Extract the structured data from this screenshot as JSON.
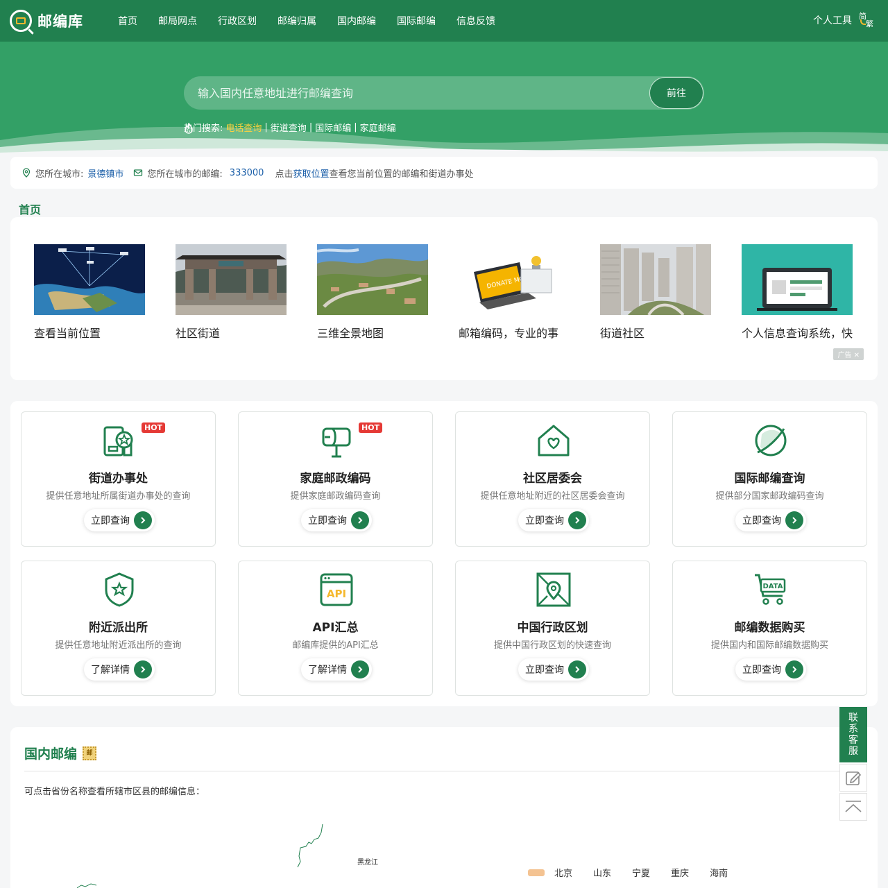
{
  "header": {
    "logo_text": "邮编库",
    "nav": [
      "首页",
      "邮局网点",
      "行政区划",
      "邮编归属",
      "国内邮编",
      "国际邮编",
      "信息反馈"
    ],
    "tools_label": "个人工具",
    "lang_a": "简",
    "lang_b": "繁"
  },
  "search": {
    "placeholder": "输入国内任意地址进行邮编查询",
    "button": "前往",
    "hot_label": "热门搜索:",
    "hot_highlight": "电话查询",
    "hot_links": [
      "街道查询",
      "国际邮编",
      "家庭邮编"
    ],
    "separator": "|"
  },
  "location": {
    "city_label": "您所在城市:",
    "city": "景德镇市",
    "postcode_label": "您所在城市的邮编:",
    "postcode": "333000",
    "prompt_prefix": "点击",
    "prompt_link": "获取位置",
    "prompt_suffix": "查看您当前位置的邮编和街道办事处"
  },
  "breadcrumb": "首页",
  "gallery": {
    "items": [
      {
        "caption": "查看当前位置"
      },
      {
        "caption": "社区街道"
      },
      {
        "caption": "三维全景地图"
      },
      {
        "caption": "邮箱编码，专业的事"
      },
      {
        "caption": "街道社区"
      },
      {
        "caption": "个人信息查询系统，快"
      }
    ],
    "ad_label": "广告",
    "donate_text": "DONATE MONEY"
  },
  "services": [
    {
      "title": "街道办事处",
      "desc": "提供任意地址所属街道办事处的查询",
      "button": "立即查询",
      "badge": "HOT",
      "icon": "id-badge-icon"
    },
    {
      "title": "家庭邮政编码",
      "desc": "提供家庭邮政编码查询",
      "button": "立即查询",
      "badge": "HOT",
      "icon": "mailbox-icon"
    },
    {
      "title": "社区居委会",
      "desc": "提供任意地址附近的社区居委会查询",
      "button": "立即查询",
      "badge": "",
      "icon": "house-heart-icon"
    },
    {
      "title": "国际邮编查询",
      "desc": "提供部分国家邮政编码查询",
      "button": "立即查询",
      "badge": "",
      "icon": "globe-icon"
    },
    {
      "title": "附近派出所",
      "desc": "提供任意地址附近派出所的查询",
      "button": "了解详情",
      "badge": "",
      "icon": "shield-star-icon"
    },
    {
      "title": "API汇总",
      "desc": "邮编库提供的API汇总",
      "button": "了解详情",
      "badge": "",
      "icon": "api-window-icon"
    },
    {
      "title": "中国行政区划",
      "desc": "提供中国行政区划的快速查询",
      "button": "立即查询",
      "badge": "",
      "icon": "map-pin-icon"
    },
    {
      "title": "邮编数据购买",
      "desc": "提供国内和国际邮编数据购买",
      "button": "立即查询",
      "badge": "",
      "icon": "data-cart-icon"
    }
  ],
  "service_icon_text": {
    "api": "API",
    "data": "DATA"
  },
  "province": {
    "title": "国内邮编",
    "stamp": "邮",
    "desc": "可点击省份名称查看所辖市区县的邮编信息：",
    "map_label": "黑龙江",
    "legend": [
      "北京",
      "山东",
      "宁夏",
      "重庆",
      "海南"
    ]
  },
  "side": {
    "contact": "联系客服"
  },
  "colors": {
    "brand_green": "#21804f",
    "hero_green": "#33a066",
    "hot_red": "#e53935",
    "highlight_yellow": "#ffd23f",
    "link_blue": "#1a5ea8"
  }
}
